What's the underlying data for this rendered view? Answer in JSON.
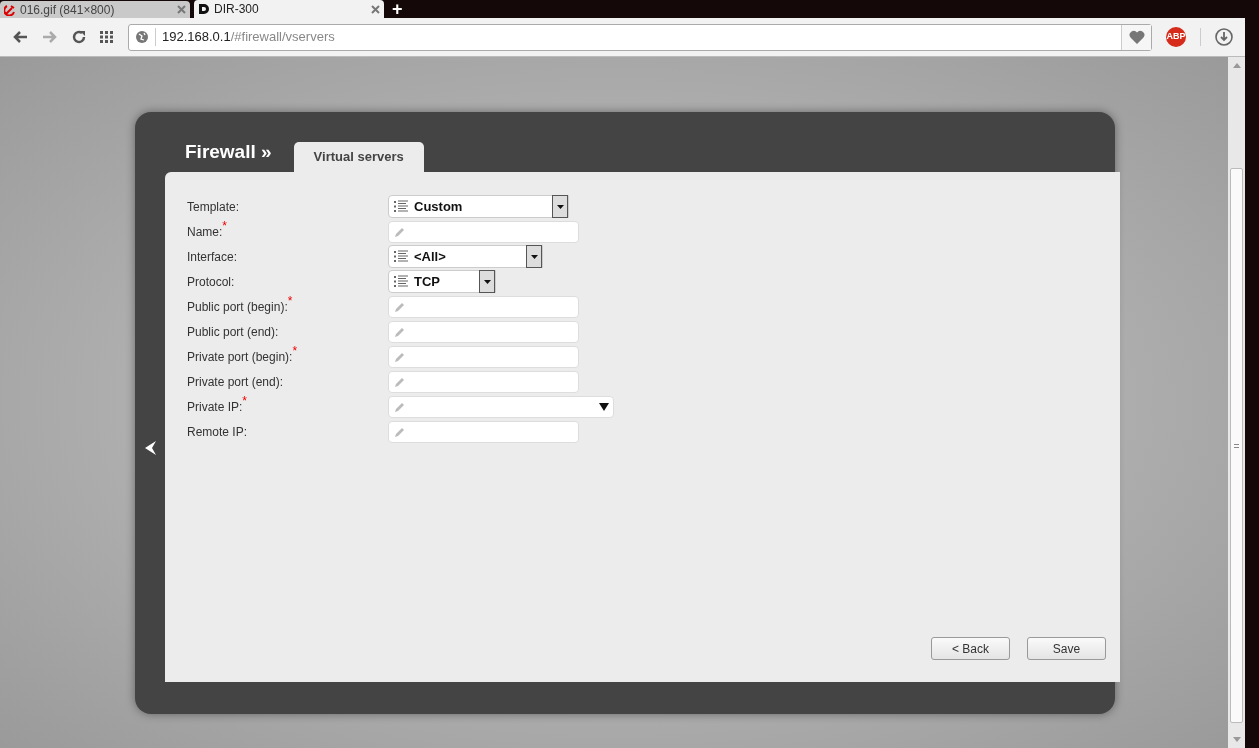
{
  "browser": {
    "tabs": [
      {
        "title": "016.gif (841×800)",
        "selected": false
      },
      {
        "title": "DIR-300",
        "selected": true
      }
    ],
    "new_tab": "+",
    "url": {
      "host": "192.168.0.1",
      "path": "/#firewall/vservers"
    },
    "adblock": "ABP"
  },
  "page": {
    "section": "Firewall »",
    "tabs": [
      {
        "label": "Virtual servers",
        "selected": true
      }
    ],
    "fields": [
      {
        "kind": "select",
        "label": "Template:",
        "value": "Custom"
      },
      {
        "kind": "text",
        "label": "Name:$^{*}$"
      },
      {
        "kind": "select",
        "label": "Interface:",
        "value": "<All>"
      },
      {
        "kind": "select",
        "label": "Protocol:",
        "value": "TCP"
      },
      {
        "kind": "text",
        "label": "Public port (begin):$^{*}$"
      },
      {
        "kind": "text",
        "label": "Public port (end):"
      },
      {
        "kind": "text",
        "label": "Private port (begin):$^{*}$"
      },
      {
        "kind": "text",
        "label": "Private port (end):"
      },
      {
        "kind": "combo",
        "label": "Private IP:$^{*}$"
      },
      {
        "kind": "text",
        "label": "Remote IP:"
      }
    ],
    "buttons": [
      "< Back",
      "Save"
    ]
  }
}
